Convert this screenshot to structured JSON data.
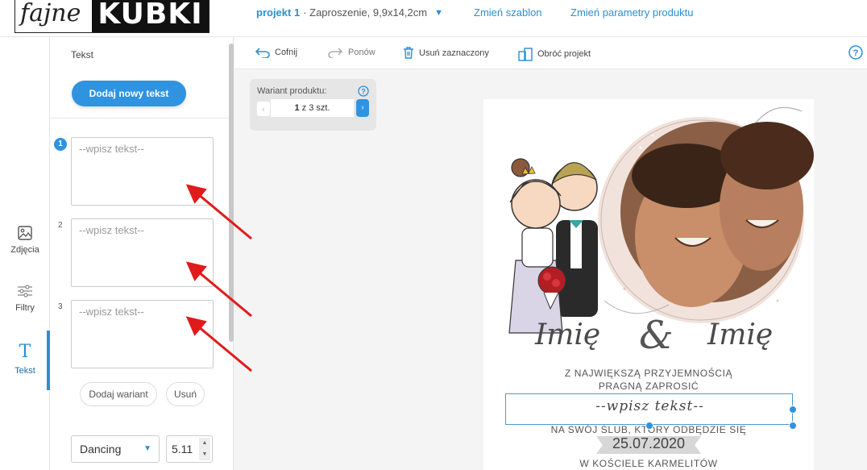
{
  "header": {
    "logo_script": "fajne",
    "logo_bold": "KUBKI",
    "project_name": "projekt 1",
    "project_desc": "· Zaproszenie, 9,9x14,2cm",
    "change_template": "Zmień szablon",
    "change_params": "Zmień parametry produktu"
  },
  "rail": {
    "items": [
      {
        "label": "Zdjęcia",
        "icon": "image-icon"
      },
      {
        "label": "Filtry",
        "icon": "sliders-icon"
      },
      {
        "label": "Tekst",
        "icon": "text-icon"
      }
    ]
  },
  "panel": {
    "title": "Tekst",
    "add_button": "Dodaj nowy tekst",
    "fields": [
      {
        "number": "1",
        "placeholder": "--wpisz tekst--"
      },
      {
        "number": "2",
        "placeholder": "--wpisz tekst--"
      },
      {
        "number": "3",
        "placeholder": "--wpisz tekst--"
      }
    ],
    "add_variant": "Dodaj wariant",
    "remove": "Usuń",
    "font_family": "Dancing",
    "font_size": "5.11"
  },
  "toolbar": {
    "undo": "Cofnij",
    "redo": "Ponów",
    "delete_selected": "Usuń zaznaczony",
    "rotate": "Obróć projekt"
  },
  "variant": {
    "label": "Wariant produktu:",
    "current": "1",
    "of_total": "z 3 szt."
  },
  "card": {
    "name_left": "Imię",
    "ampersand": "&",
    "name_right": "Imię",
    "line1": "Z NAJWIĘKSZĄ PRZYJEMNOŚCIĄ",
    "line2": "PRAGNĄ ZAPROSIĆ",
    "selected_placeholder": "--wpisz tekst--",
    "line3": "NA SWÓJ ŚLUB, KTÓRY ODBĘDZIE SIĘ",
    "date": "25.07.2020",
    "line4": "W KOŚCIELE KARMELITÓW"
  },
  "colors": {
    "accent": "#2f93e0",
    "annotation_arrow": "#e01b1b"
  }
}
